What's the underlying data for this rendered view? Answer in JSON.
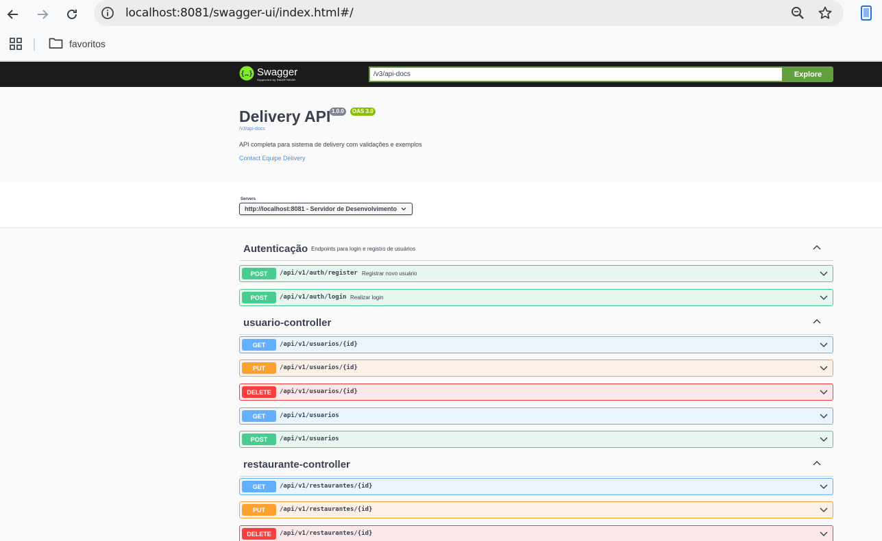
{
  "browser": {
    "url": "localhost:8081/swagger-ui/index.html#/",
    "bookmark_folder": "favoritos"
  },
  "topbar": {
    "logo_title": "Swagger",
    "logo_subtitle": "Supported by SMARTBEAR",
    "spec_url": "/v3/api-docs",
    "explore_label": "Explore"
  },
  "info": {
    "title": "Delivery API",
    "version": "1.0.0",
    "oas": "OAS 3.0",
    "spec_link": "/v3/api-docs",
    "description": "API completa para sistema de delivery com validações e exemplos",
    "contact": "Contact Equipe Delivery"
  },
  "servers": {
    "label": "Servers",
    "selected": "http://localhost:8081 - Servidor de Desenvolvimento"
  },
  "tags": [
    {
      "name": "Autenticação",
      "description": "Endpoints para login e registro de usuários",
      "ops": [
        {
          "method": "POST",
          "path": "/api/v1/auth/register",
          "summary": "Registrar novo usuário"
        },
        {
          "method": "POST",
          "path": "/api/v1/auth/login",
          "summary": "Realizar login"
        }
      ]
    },
    {
      "name": "usuario-controller",
      "description": "",
      "ops": [
        {
          "method": "GET",
          "path": "/api/v1/usuarios/{id}",
          "summary": ""
        },
        {
          "method": "PUT",
          "path": "/api/v1/usuarios/{id}",
          "summary": ""
        },
        {
          "method": "DELETE",
          "path": "/api/v1/usuarios/{id}",
          "summary": ""
        },
        {
          "method": "GET",
          "path": "/api/v1/usuarios",
          "summary": ""
        },
        {
          "method": "POST",
          "path": "/api/v1/usuarios",
          "summary": ""
        }
      ]
    },
    {
      "name": "restaurante-controller",
      "description": "",
      "ops": [
        {
          "method": "GET",
          "path": "/api/v1/restaurantes/{id}",
          "summary": ""
        },
        {
          "method": "PUT",
          "path": "/api/v1/restaurantes/{id}",
          "summary": ""
        },
        {
          "method": "DELETE",
          "path": "/api/v1/restaurantes/{id}",
          "summary": ""
        }
      ]
    }
  ]
}
